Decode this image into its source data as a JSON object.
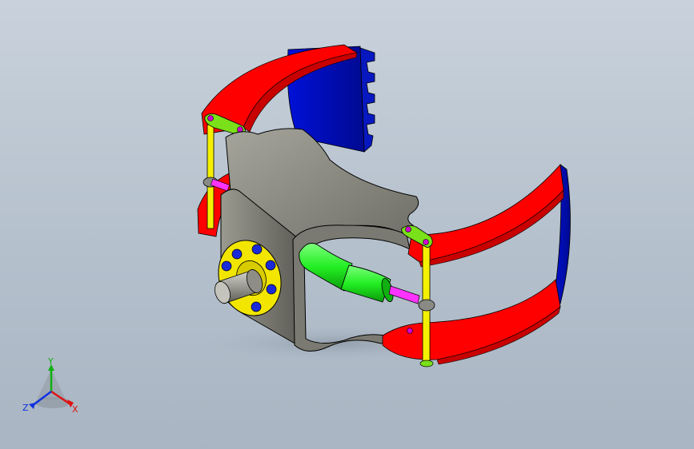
{
  "viewport": {
    "background_top": "#c9d2dc",
    "background_bottom": "#a9b5c2"
  },
  "model": {
    "colors": {
      "jaw": "#ff0000",
      "jaw_dark": "#c80000",
      "liner": "#0010c8",
      "liner_dark": "#000a90",
      "frame": "#8a8a80",
      "frame_dark": "#5e5e56",
      "flange": "#f2e600",
      "bolt": "#1a2ad8",
      "shaft": "#9a9a92",
      "cylinder": "#22ee22",
      "cylinder_dark": "#10b010",
      "rod": "#ff33ff",
      "pin": "#f5f000",
      "link": "#7ae01a",
      "hole": "#d000d0"
    }
  },
  "triad": {
    "x_label": "X",
    "y_label": "Y",
    "z_label": "Z",
    "x_color": "#e01010",
    "y_color": "#10b010",
    "z_color": "#1030e0"
  }
}
